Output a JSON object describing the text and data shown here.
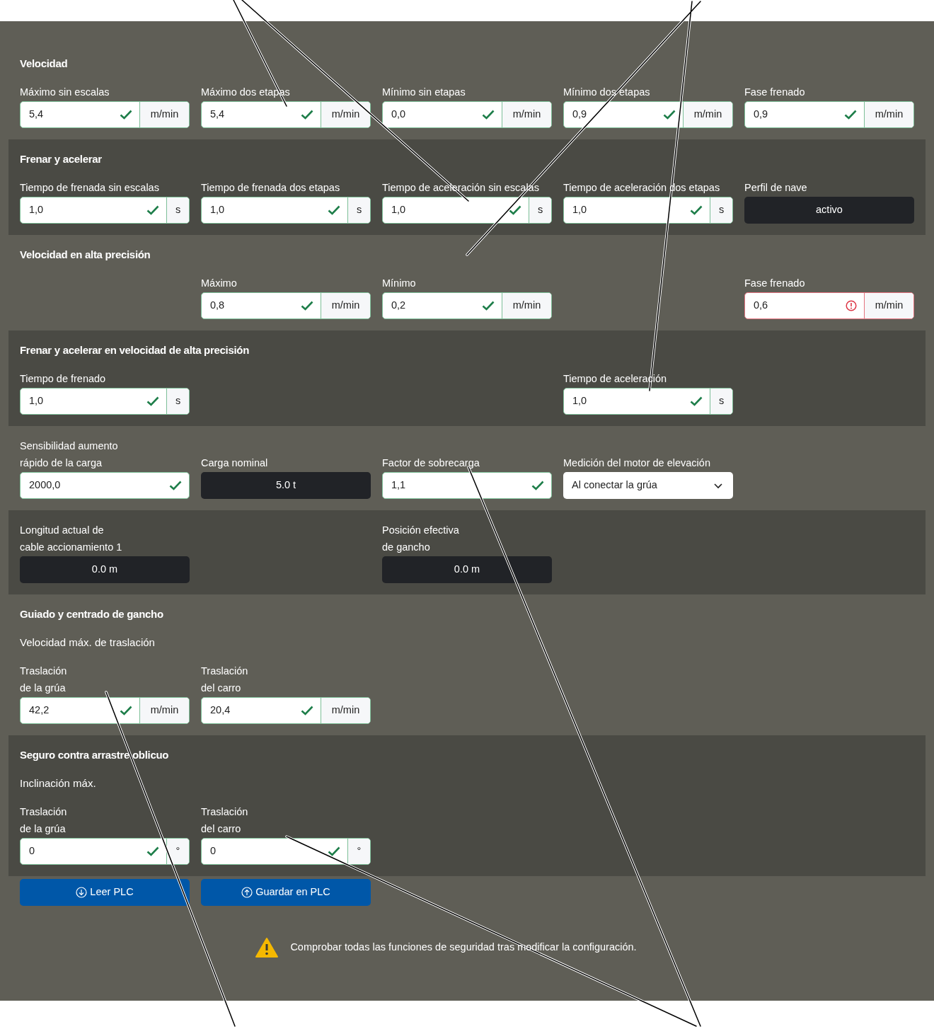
{
  "sections": [
    {
      "kind": "plain",
      "heading": "Velocidad",
      "cells": [
        {
          "kind": "input",
          "label": [
            "Máximo sin escalas"
          ],
          "value": "5,4",
          "valid": true,
          "unit": "m/min"
        },
        {
          "kind": "input",
          "label": [
            "Máximo dos etapas"
          ],
          "value": "5,4",
          "valid": true,
          "unit": "m/min"
        },
        {
          "kind": "input",
          "label": [
            "Mínimo sin etapas"
          ],
          "value": "0,0",
          "valid": true,
          "unit": "m/min"
        },
        {
          "kind": "input",
          "label": [
            "Mínimo dos etapas"
          ],
          "value": "0,9",
          "valid": true,
          "unit": "m/min"
        },
        {
          "kind": "input",
          "label": [
            "Fase frenado"
          ],
          "value": "0,9",
          "valid": true,
          "unit": "m/min"
        }
      ]
    },
    {
      "kind": "shaded",
      "heading": "Frenar y acelerar",
      "cells": [
        {
          "kind": "input",
          "label": [
            "Tiempo de frenada sin escalas"
          ],
          "value": "1,0",
          "valid": true,
          "unit": "s"
        },
        {
          "kind": "input",
          "label": [
            "Tiempo de frenada dos etapas"
          ],
          "value": "1,0",
          "valid": true,
          "unit": "s"
        },
        {
          "kind": "input",
          "label": [
            "Tiempo de aceleración sin escalas"
          ],
          "value": "1,0",
          "valid": true,
          "unit": "s"
        },
        {
          "kind": "input",
          "label": [
            "Tiempo de aceleración dos etapas"
          ],
          "value": "1,0",
          "valid": true,
          "unit": "s"
        },
        {
          "kind": "display",
          "label": [
            "Perfil de nave"
          ],
          "value": "activo"
        }
      ]
    },
    {
      "kind": "plain",
      "heading": "Velocidad en alta precisión",
      "cells": [
        {
          "kind": "empty"
        },
        {
          "kind": "input",
          "label": [
            "Máximo"
          ],
          "value": "0,8",
          "valid": true,
          "unit": "m/min"
        },
        {
          "kind": "input",
          "label": [
            "Mínimo"
          ],
          "value": "0,2",
          "valid": true,
          "unit": "m/min"
        },
        {
          "kind": "empty"
        },
        {
          "kind": "input",
          "label": [
            "Fase frenado"
          ],
          "value": "0,6",
          "valid": false,
          "unit": "m/min"
        }
      ]
    },
    {
      "kind": "shaded",
      "heading": "Frenar y acelerar en velocidad de alta precisión",
      "cells": [
        {
          "kind": "input",
          "label": [
            "Tiempo de frenado"
          ],
          "value": "1,0",
          "valid": true,
          "unit": "s"
        },
        {
          "kind": "empty"
        },
        {
          "kind": "empty"
        },
        {
          "kind": "input",
          "label": [
            "Tiempo de aceleración"
          ],
          "value": "1,0",
          "valid": true,
          "unit": "s"
        }
      ]
    },
    {
      "kind": "plain",
      "cells": [
        {
          "kind": "input",
          "label": [
            "Sensibilidad aumento",
            "rápido de la carga"
          ],
          "value": "2000,0",
          "valid": true
        },
        {
          "kind": "display",
          "label": [
            "Carga nominal"
          ],
          "value": "5.0 t"
        },
        {
          "kind": "input",
          "label": [
            "Factor de sobrecarga"
          ],
          "value": "1,1",
          "valid": true
        },
        {
          "kind": "select",
          "label": [
            "Medición del motor de elevación"
          ],
          "value": "Al conectar la grúa"
        }
      ]
    },
    {
      "kind": "shaded",
      "cells": [
        {
          "kind": "display",
          "label": [
            "Longitud actual de",
            "cable accionamiento 1"
          ],
          "value": "0.0 m"
        },
        {
          "kind": "empty"
        },
        {
          "kind": "display",
          "label": [
            "Posición efectiva",
            "de gancho"
          ],
          "value": "0.0 m"
        }
      ]
    },
    {
      "kind": "plain",
      "heading": "Guiado y centrado de gancho",
      "subheading": "Velocidad máx. de traslación",
      "cells": [
        {
          "kind": "input",
          "label": [
            "Traslación",
            "de la grúa"
          ],
          "value": "42,2",
          "valid": true,
          "unit": "m/min"
        },
        {
          "kind": "input",
          "label": [
            "Traslación",
            "del carro"
          ],
          "value": "20,4",
          "valid": true,
          "unit": "m/min"
        }
      ]
    },
    {
      "kind": "shaded",
      "heading": "Seguro contra arrastre oblicuo",
      "subheading": "Inclinación máx.",
      "cells": [
        {
          "kind": "input",
          "label": [
            "Traslación",
            "de la grúa"
          ],
          "value": "0",
          "valid": true,
          "unit": "°"
        },
        {
          "kind": "input",
          "label": [
            "Traslación",
            "del carro"
          ],
          "value": "0",
          "valid": true,
          "unit": "°"
        }
      ]
    }
  ],
  "buttons": [
    {
      "kind": "read",
      "label": "Leer PLC"
    },
    {
      "kind": "save",
      "label": "Guardar en PLC"
    }
  ],
  "warning": "Comprobar todas las funciones de seguridad tras modificar la configuración."
}
